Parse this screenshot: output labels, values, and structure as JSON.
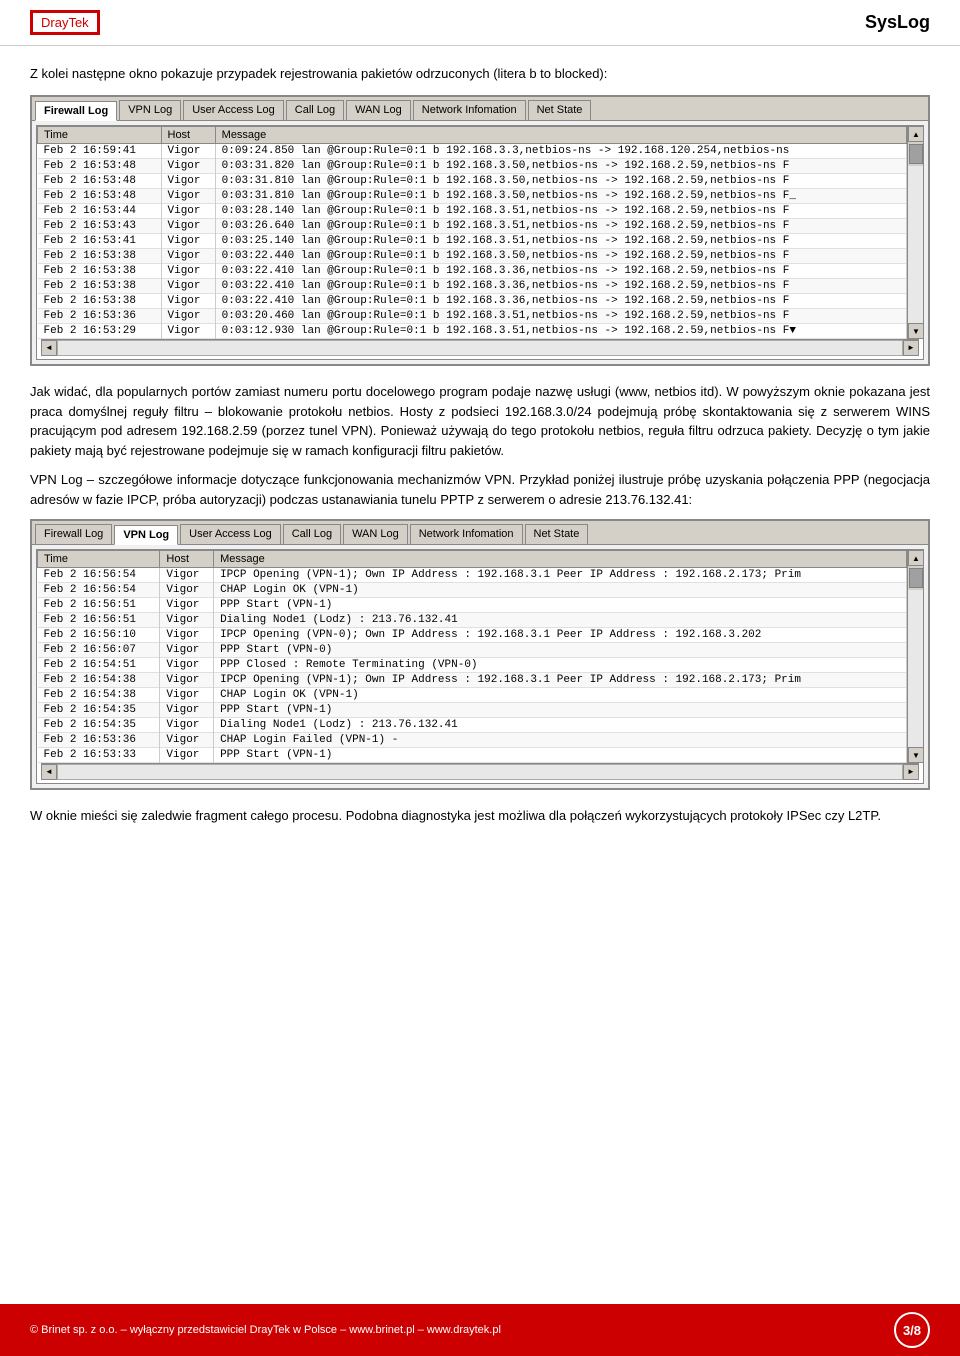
{
  "header": {
    "logo_dray": "Dray",
    "logo_tek": "Tek",
    "syslog_label": "SysLog"
  },
  "intro": {
    "text1": "Z kolei następne okno pokazuje przypadek rejestrowania pakietów odrzuconych (litera b to blocked):"
  },
  "log1": {
    "tabs": [
      "Firewall Log",
      "VPN Log",
      "User Access Log",
      "Call Log",
      "WAN Log",
      "Network Infomation",
      "Net State"
    ],
    "active_tab": "Firewall Log",
    "columns": [
      "Time",
      "Host",
      "Message"
    ],
    "rows": [
      [
        "Feb 2 16:59:41",
        "Vigor",
        "0:09:24.850 lan @Group:Rule=0:1 b 192.168.3.3,netbios-ns -> 192.168.120.254,netbios-ns"
      ],
      [
        "Feb 2 16:53:48",
        "Vigor",
        "0:03:31.820 lan @Group:Rule=0:1 b 192.168.3.50,netbios-ns -> 192.168.2.59,netbios-ns  F"
      ],
      [
        "Feb 2 16:53:48",
        "Vigor",
        "0:03:31.810 lan @Group:Rule=0:1 b 192.168.3.50,netbios-ns -> 192.168.2.59,netbios-ns  F"
      ],
      [
        "Feb 2 16:53:48",
        "Vigor",
        "0:03:31.810 lan @Group:Rule=0:1 b 192.168.3.50,netbios-ns -> 192.168.2.59,netbios-ns  F_"
      ],
      [
        "Feb 2 16:53:44",
        "Vigor",
        "0:03:28.140 lan @Group:Rule=0:1 b 192.168.3.51,netbios-ns -> 192.168.2.59,netbios-ns  F"
      ],
      [
        "Feb 2 16:53:43",
        "Vigor",
        "0:03:26.640 lan @Group:Rule=0:1 b 192.168.3.51,netbios-ns -> 192.168.2.59,netbios-ns  F"
      ],
      [
        "Feb 2 16:53:41",
        "Vigor",
        "0:03:25.140 lan @Group:Rule=0:1 b 192.168.3.51,netbios-ns -> 192.168.2.59,netbios-ns  F"
      ],
      [
        "Feb 2 16:53:38",
        "Vigor",
        "0:03:22.440 lan @Group:Rule=0:1 b 192.168.3.50,netbios-ns -> 192.168.2.59,netbios-ns  F"
      ],
      [
        "Feb 2 16:53:38",
        "Vigor",
        "0:03:22.410 lan @Group:Rule=0:1 b 192.168.3.36,netbios-ns -> 192.168.2.59,netbios-ns  F"
      ],
      [
        "Feb 2 16:53:38",
        "Vigor",
        "0:03:22.410 lan @Group:Rule=0:1 b 192.168.3.36,netbios-ns -> 192.168.2.59,netbios-ns  F"
      ],
      [
        "Feb 2 16:53:38",
        "Vigor",
        "0:03:22.410 lan @Group:Rule=0:1 b 192.168.3.36,netbios-ns -> 192.168.2.59,netbios-ns  F"
      ],
      [
        "Feb 2 16:53:36",
        "Vigor",
        "0:03:20.460 lan @Group:Rule=0:1 b 192.168.3.51,netbios-ns -> 192.168.2.59,netbios-ns  F"
      ],
      [
        "Feb 2 16:53:29",
        "Vigor",
        "0:03:12.930 lan @Group:Rule=0:1 b 192.168.3.51,netbios-ns -> 192.168.2.59,netbios-ns  F▼"
      ]
    ]
  },
  "body1": {
    "para1": "Jak widać, dla popularnych portów zamiast numeru portu docelowego program podaje nazwę usługi (www, netbios itd). W powyższym oknie pokazana jest praca domyślnej reguły filtru – blokowanie protokołu netbios. Hosty z podsieci 192.168.3.0/24 podejmują próbę skontaktowania się z serwerem WINS pracującym pod adresem 192.168.2.59 (porzez tunel VPN). Ponieważ używają do tego protokołu netbios, reguła filtru odrzuca pakiety. Decyzję o tym jakie pakiety mają być rejestrowane podejmuje się w ramach konfiguracji filtru pakietów.",
    "para2": "VPN Log – szczegółowe informacje dotyczące funkcjonowania mechanizmów VPN. Przykład poniżej ilustruje próbę uzyskania połączenia PPP (negocjacja adresów w fazie IPCP, próba autoryzacji) podczas ustanawiania tunelu PPTP z serwerem o adresie 213.76.132.41:"
  },
  "log2": {
    "tabs": [
      "Firewall Log",
      "VPN Log",
      "User Access Log",
      "Call Log",
      "WAN Log",
      "Network Infomation",
      "Net State"
    ],
    "active_tab": "VPN Log",
    "columns": [
      "Time",
      "Host",
      "Message"
    ],
    "rows": [
      [
        "Feb 2 16:56:54",
        "Vigor",
        "IPCP Opening (VPN-1); Own IP Address : 192.168.3.1 Peer IP Address : 192.168.2.173; Prim"
      ],
      [
        "Feb 2 16:56:54",
        "Vigor",
        "CHAP Login OK (VPN-1)"
      ],
      [
        "Feb 2 16:56:51",
        "Vigor",
        "PPP Start (VPN-1)"
      ],
      [
        "Feb 2 16:56:51",
        "Vigor",
        "Dialing Node1 (Lodz) : 213.76.132.41"
      ],
      [
        "Feb 2 16:56:10",
        "Vigor",
        "IPCP Opening (VPN-0); Own IP Address : 192.168.3.1 Peer IP Address : 192.168.3.202"
      ],
      [
        "Feb 2 16:56:07",
        "Vigor",
        "PPP Start (VPN-0)"
      ],
      [
        "Feb 2 16:54:51",
        "Vigor",
        "PPP Closed : Remote Terminating (VPN-0)"
      ],
      [
        "Feb 2 16:54:38",
        "Vigor",
        "IPCP Opening (VPN-1); Own IP Address : 192.168.3.1 Peer IP Address : 192.168.2.173; Prim"
      ],
      [
        "Feb 2 16:54:38",
        "Vigor",
        "CHAP Login OK (VPN-1)"
      ],
      [
        "Feb 2 16:54:35",
        "Vigor",
        "PPP Start (VPN-1)"
      ],
      [
        "Feb 2 16:54:35",
        "Vigor",
        "Dialing Node1 (Lodz) : 213.76.132.41"
      ],
      [
        "Feb 2 16:53:36",
        "Vigor",
        "CHAP Login Failed (VPN-1) -"
      ],
      [
        "Feb 2 16:53:33",
        "Vigor",
        "PPP Start (VPN-1)"
      ]
    ]
  },
  "body2": {
    "para1": "W oknie mieści się zaledwie fragment całego procesu. Podobna diagnostyka jest możliwa dla połączeń wykorzystujących protokoły IPSec czy L2TP."
  },
  "footer": {
    "copyright": "© Brinet sp. z o.o. – wyłączny przedstawiciel DrayTek w Polsce – www.brinet.pl – www.draytek.pl",
    "page": "3/8"
  }
}
